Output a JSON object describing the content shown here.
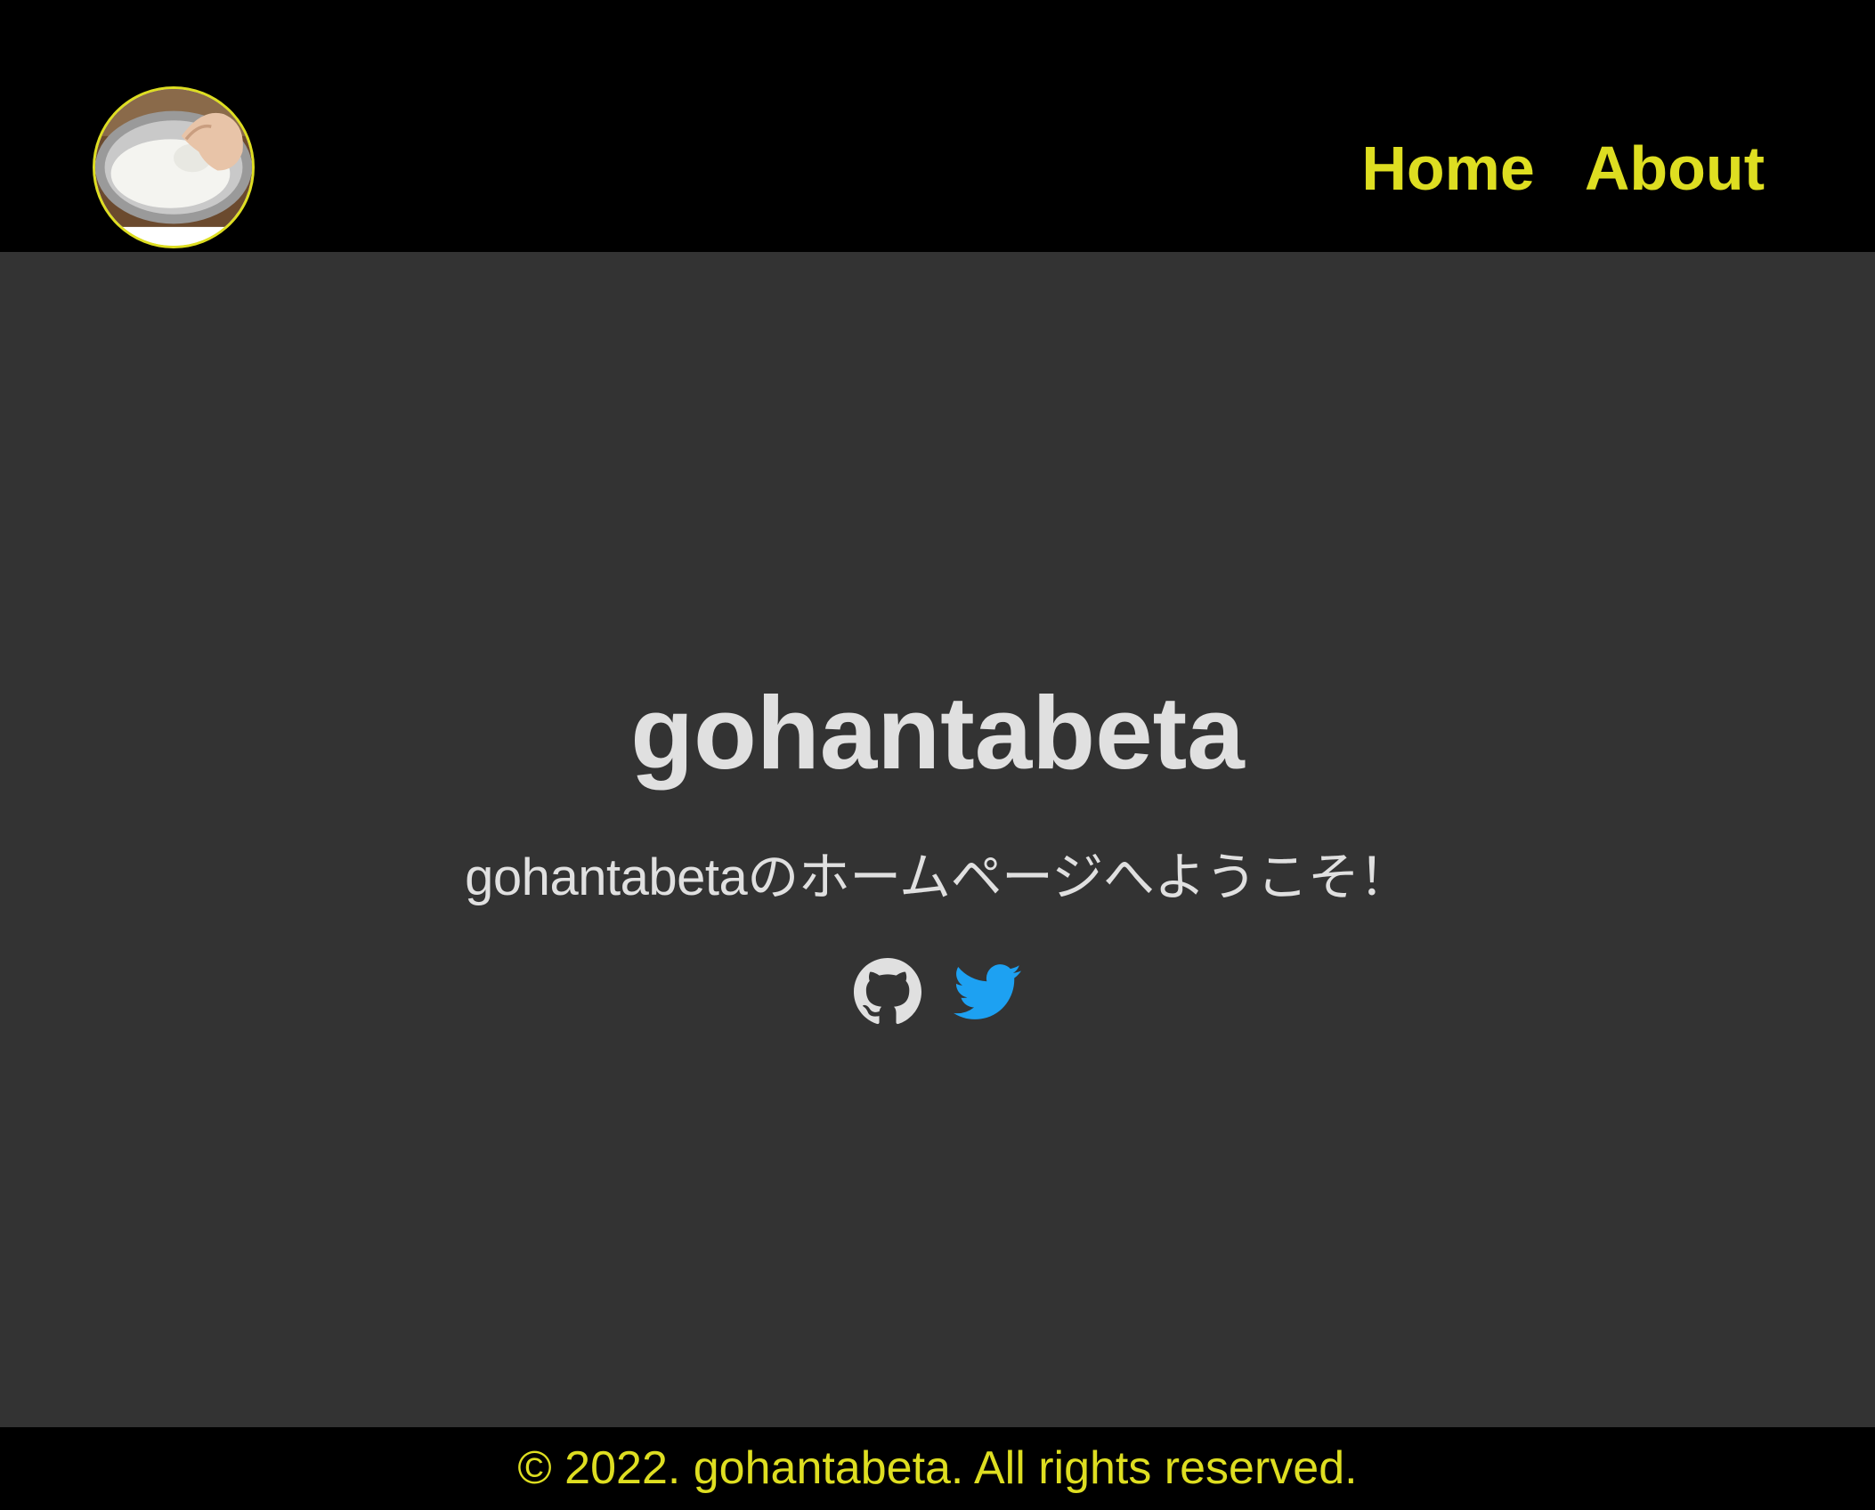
{
  "header": {
    "logo_alt": "rice washing bowl",
    "nav": [
      {
        "label": "Home"
      },
      {
        "label": "About"
      }
    ]
  },
  "hero": {
    "title": "gohantabeta",
    "subtitle": "gohantabetaのホームページへようこそ！",
    "social": [
      {
        "icon": "github-icon",
        "color": "#e0e0e0"
      },
      {
        "icon": "twitter-icon",
        "color": "#1da1f2"
      }
    ]
  },
  "footer": {
    "copyright": "© 2022. gohantabeta. All rights reserved."
  },
  "colors": {
    "accent": "#dede21",
    "header_bg": "#000000",
    "body_bg": "#333333",
    "text": "#e0e0e0",
    "twitter": "#1da1f2"
  }
}
